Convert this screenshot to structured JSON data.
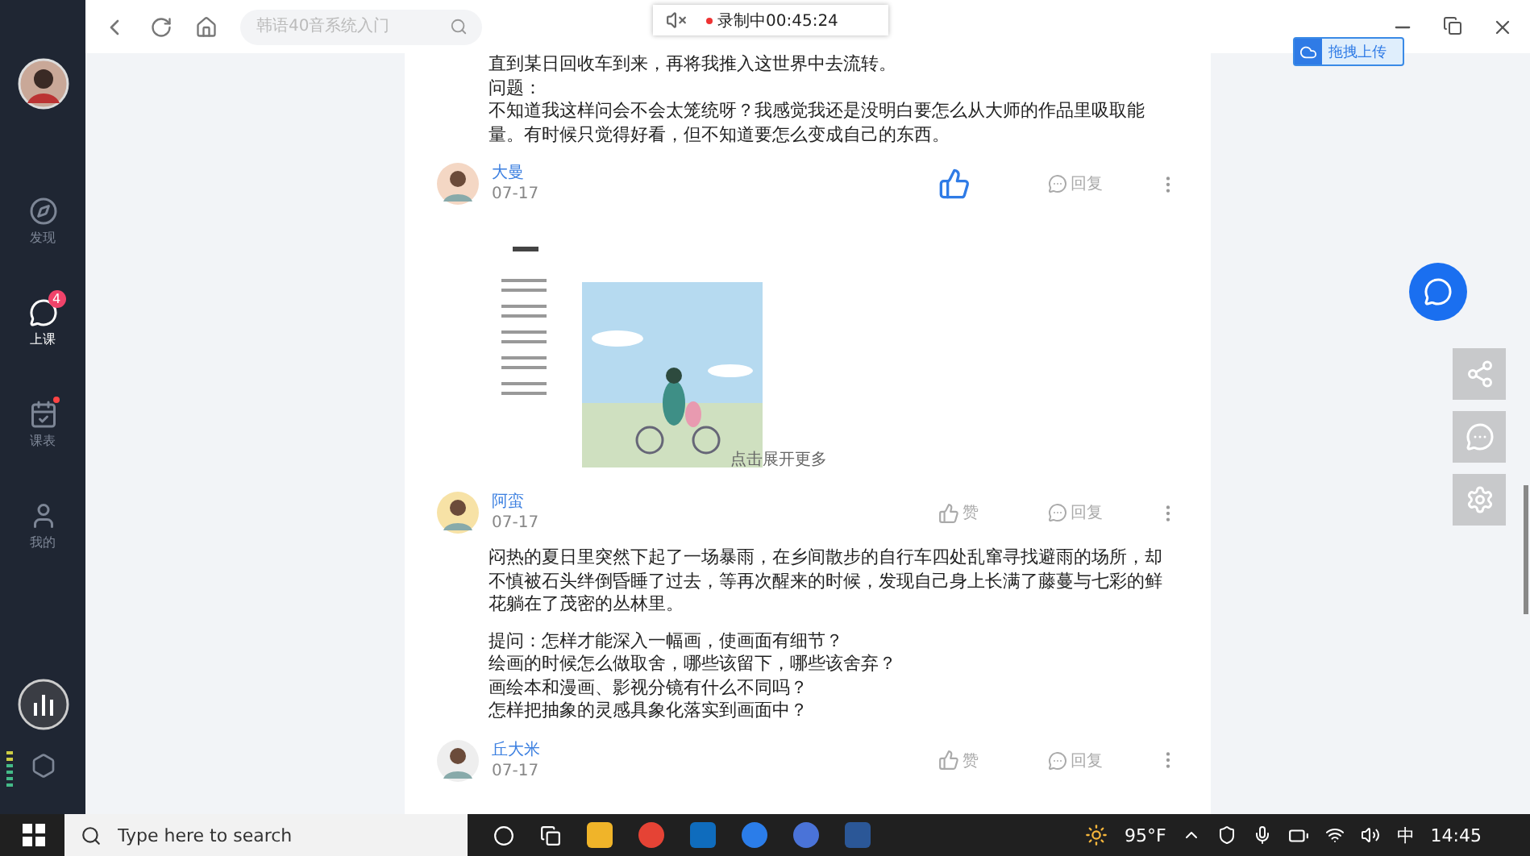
{
  "toolbar": {
    "search": {
      "placeholder": "韩语40音系统入门"
    },
    "recording": "录制中00:45:24"
  },
  "upload_button": "拖拽上传",
  "sidebar": {
    "items": [
      {
        "kind": "discover",
        "label": "发现",
        "selected": false,
        "dot": false
      },
      {
        "kind": "class",
        "label": "上课",
        "selected": true,
        "badge": "4",
        "dot": false
      },
      {
        "kind": "schedule",
        "label": "课表",
        "selected": false,
        "dot": true
      },
      {
        "kind": "me",
        "label": "我的",
        "selected": false,
        "dot": false
      }
    ]
  },
  "feed": {
    "intro_lines": [
      "直到某日回收车到来，再将我推入这世界中去流转。",
      "问题：",
      "不知道我这样问会不会太笼统呀？我感觉我还是没明白要怎么从大师的作品里吸取能量。有时候只觉得好看，但不知道要怎么变成自己的东西。"
    ],
    "comments": [
      {
        "author": "大曼",
        "date": "07-17",
        "liked": true,
        "reply_label": "回复",
        "attachment": {
          "kind": "picture",
          "expand_label": "点击展开更多"
        }
      },
      {
        "author": "阿蛮",
        "date": "07-17",
        "liked": false,
        "like_label": "赞",
        "reply_label": "回复",
        "paragraphs": [
          "闷热的夏日里突然下起了一场暴雨，在乡间散步的自行车四处乱窜寻找避雨的场所，却不慎被石头绊倒昏睡了过去，等再次醒来的时候，发现自己身上长满了藤蔓与七彩的鲜花躺在了茂密的丛林里。"
        ],
        "questions": [
          "提问：怎样才能深入一幅画，使画面有细节？",
          "绘画的时候怎么做取舍，哪些该留下，哪些该舍弃？",
          "画绘本和漫画、影视分镜有什么不同吗？",
          "怎样把抽象的灵感具象化落实到画面中？"
        ]
      },
      {
        "author": "丘大米",
        "date": "07-17",
        "liked": false,
        "like_label": "赞",
        "reply_label": "回复"
      }
    ]
  },
  "taskbar": {
    "search_placeholder": "Type here to search",
    "weather": "95°F",
    "ime": "中",
    "time": "14:45"
  }
}
